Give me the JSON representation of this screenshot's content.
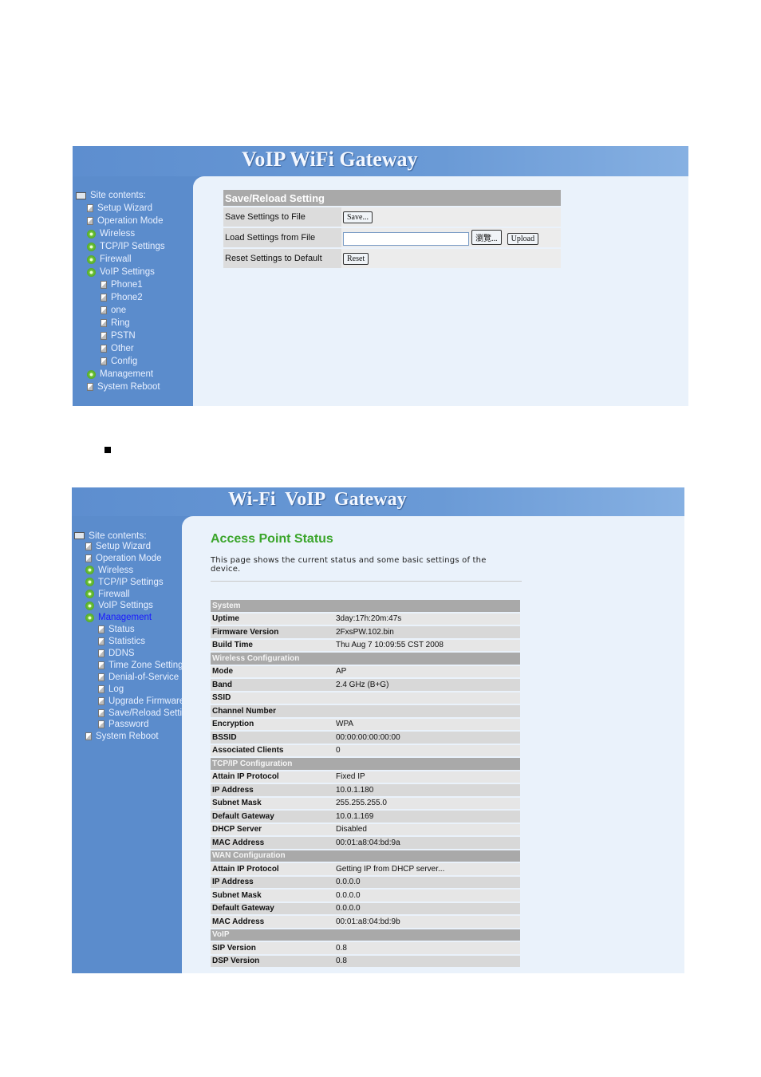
{
  "shot1": {
    "title": "VoIP WiFi Gateway",
    "sidebar_heading": "Site contents:",
    "sidebar": [
      {
        "label": "Setup Wizard",
        "icon": "page",
        "level": 1
      },
      {
        "label": "Operation Mode",
        "icon": "page",
        "level": 1
      },
      {
        "label": "Wireless",
        "icon": "folder",
        "level": 1
      },
      {
        "label": "TCP/IP Settings",
        "icon": "folder",
        "level": 1
      },
      {
        "label": "Firewall",
        "icon": "folder",
        "level": 1
      },
      {
        "label": "VoIP Settings",
        "icon": "folder",
        "level": 1
      },
      {
        "label": "Phone1",
        "icon": "page",
        "level": 2
      },
      {
        "label": "Phone2",
        "icon": "page",
        "level": 2
      },
      {
        "label": "one",
        "icon": "page",
        "level": 2
      },
      {
        "label": "Ring",
        "icon": "page",
        "level": 2
      },
      {
        "label": "PSTN",
        "icon": "page",
        "level": 2
      },
      {
        "label": "Other",
        "icon": "page",
        "level": 2
      },
      {
        "label": "Config",
        "icon": "page",
        "level": 2
      },
      {
        "label": "Management",
        "icon": "folder",
        "level": 1
      },
      {
        "label": "System Reboot",
        "icon": "page",
        "level": 1
      }
    ],
    "section": "Save/Reload Setting",
    "rows": {
      "save_label": "Save Settings to File",
      "save_button": "Save...",
      "load_label": "Load Settings from File",
      "load_value": "",
      "browse_button": "瀏覽...",
      "upload_button": "Upload",
      "reset_label": "Reset Settings to Default",
      "reset_button": "Reset"
    }
  },
  "shot2": {
    "title": "Wi-Fi  VoIP  Gateway",
    "sidebar_heading": "Site contents:",
    "sidebar": [
      {
        "label": "Setup Wizard",
        "icon": "page",
        "level": 1
      },
      {
        "label": "Operation Mode",
        "icon": "page",
        "level": 1
      },
      {
        "label": "Wireless",
        "icon": "folder",
        "level": 1
      },
      {
        "label": "TCP/IP Settings",
        "icon": "folder",
        "level": 1
      },
      {
        "label": "Firewall",
        "icon": "folder",
        "level": 1
      },
      {
        "label": "VoIP Settings",
        "icon": "folder",
        "level": 1
      },
      {
        "label": "Management",
        "icon": "folder",
        "level": 1,
        "active": true
      },
      {
        "label": "Status",
        "icon": "page",
        "level": 2
      },
      {
        "label": "Statistics",
        "icon": "page",
        "level": 2
      },
      {
        "label": "DDNS",
        "icon": "page",
        "level": 2
      },
      {
        "label": "Time Zone Setting",
        "icon": "page",
        "level": 2
      },
      {
        "label": "Denial-of-Service",
        "icon": "page",
        "level": 2
      },
      {
        "label": "Log",
        "icon": "page",
        "level": 2
      },
      {
        "label": "Upgrade Firmware",
        "icon": "page",
        "level": 2
      },
      {
        "label": "Save/Reload Setti",
        "icon": "page",
        "level": 2
      },
      {
        "label": "Password",
        "icon": "page",
        "level": 2
      },
      {
        "label": "System Reboot",
        "icon": "page",
        "level": 1
      }
    ],
    "page_title": "Access Point Status",
    "description": "This page shows the current status and some basic settings of the device.",
    "sections": [
      {
        "title": "System",
        "rows": [
          [
            "Uptime",
            "3day:17h:20m:47s"
          ],
          [
            "Firmware Version",
            "2FxsPW.102.bin"
          ],
          [
            "Build Time",
            "Thu Aug 7 10:09:55 CST 2008"
          ]
        ]
      },
      {
        "title": "Wireless Configuration",
        "rows": [
          [
            "Mode",
            "AP"
          ],
          [
            "Band",
            "2.4 GHz (B+G)"
          ],
          [
            "SSID",
            ""
          ],
          [
            "Channel Number",
            ""
          ],
          [
            "Encryption",
            "WPA"
          ],
          [
            "BSSID",
            "00:00:00:00:00:00"
          ],
          [
            "Associated Clients",
            "0"
          ]
        ]
      },
      {
        "title": "TCP/IP Configuration",
        "rows": [
          [
            "Attain IP Protocol",
            "Fixed IP"
          ],
          [
            "IP Address",
            "10.0.1.180"
          ],
          [
            "Subnet Mask",
            "255.255.255.0"
          ],
          [
            "Default Gateway",
            "10.0.1.169"
          ],
          [
            "DHCP Server",
            "Disabled"
          ],
          [
            "MAC Address",
            "00:01:a8:04:bd:9a"
          ]
        ]
      },
      {
        "title": "WAN Configuration",
        "rows": [
          [
            "Attain IP Protocol",
            "Getting IP from DHCP server..."
          ],
          [
            "IP Address",
            "0.0.0.0"
          ],
          [
            "Subnet Mask",
            "0.0.0.0"
          ],
          [
            "Default Gateway",
            "0.0.0.0"
          ],
          [
            "MAC Address",
            "00:01:a8:04:bd:9b"
          ]
        ]
      },
      {
        "title": "VoIP",
        "rows": [
          [
            "SIP Version",
            "0.8"
          ],
          [
            "DSP Version",
            "0.8"
          ]
        ]
      }
    ]
  }
}
